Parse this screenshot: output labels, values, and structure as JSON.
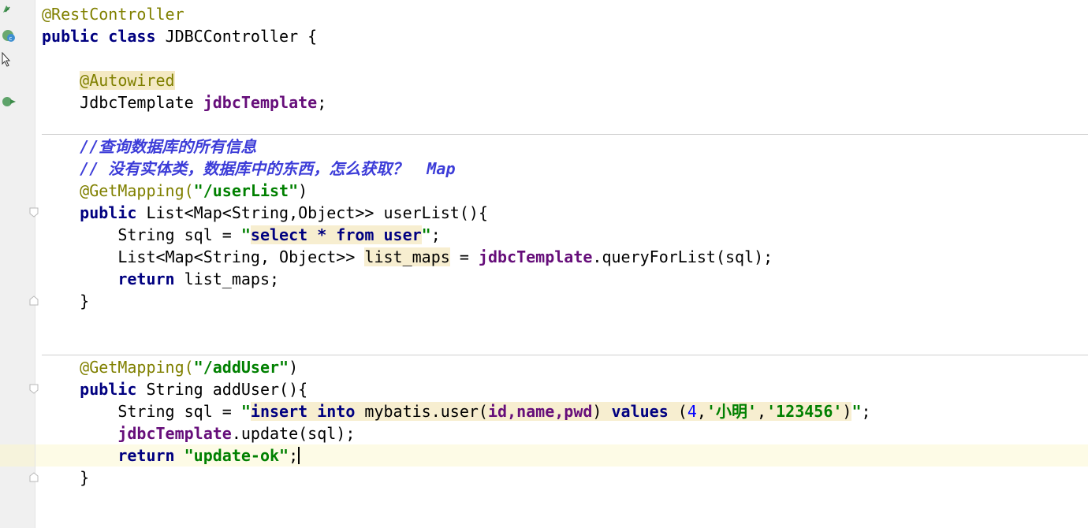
{
  "code": {
    "l1_ann": "@RestController",
    "l2_public": "public",
    "l2_class": "class",
    "l2_name": "JDBCController {",
    "l4_ann": "@Autowired",
    "l5_type": "JdbcTemplate",
    "l5_field": "jdbcTemplate",
    "l5_end": ";",
    "c1": "//查询数据库的所有信息",
    "c2": "// 没有实体类，数据库中的东西，怎么获取？  Map",
    "m1_ann": "@GetMapping(",
    "m1_path": "\"/userList\"",
    "m1_close": ")",
    "m1_public": "public",
    "m1_sig": "List<Map<String,Object>> userList(){",
    "m1_s_type": "String sql = ",
    "m1_s_q1": "\"",
    "m1_s_sql": "select * from user",
    "m1_s_q2": "\"",
    "m1_s_end": ";",
    "m1_l_type": "List<Map<String, Object>> ",
    "m1_l_var": "list_maps",
    "m1_l_eq": " = ",
    "m1_l_field": "jdbcTemplate",
    "m1_l_call": ".queryForList(sql);",
    "m1_return": "return",
    "m1_ret_val": "list_maps;",
    "m1_brace": "}",
    "m2_ann": "@GetMapping(",
    "m2_path": "\"/addUser\"",
    "m2_close": ")",
    "m2_public": "public",
    "m2_sig": "String addUser(){",
    "m2_s_type": "String sql = ",
    "m2_s_q1": "\"",
    "m2_s_insert": "insert into",
    "m2_s_table": " mybatis.user(",
    "m2_s_cols": "id,name,pwd",
    "m2_s_paren": ") ",
    "m2_s_values": "values",
    "m2_s_open": " (",
    "m2_s_num": "4",
    "m2_s_comma1": ",",
    "m2_s_str1": "'小明'",
    "m2_s_comma2": ",",
    "m2_s_str2": "'123456'",
    "m2_s_close": ")",
    "m2_s_q2": "\"",
    "m2_s_end": ";",
    "m2_u_field": "jdbcTemplate",
    "m2_u_call": ".update(sql);",
    "m2_return": "return",
    "m2_ret_str": "\"update-ok\"",
    "m2_ret_end": ";",
    "m2_brace": "}"
  }
}
